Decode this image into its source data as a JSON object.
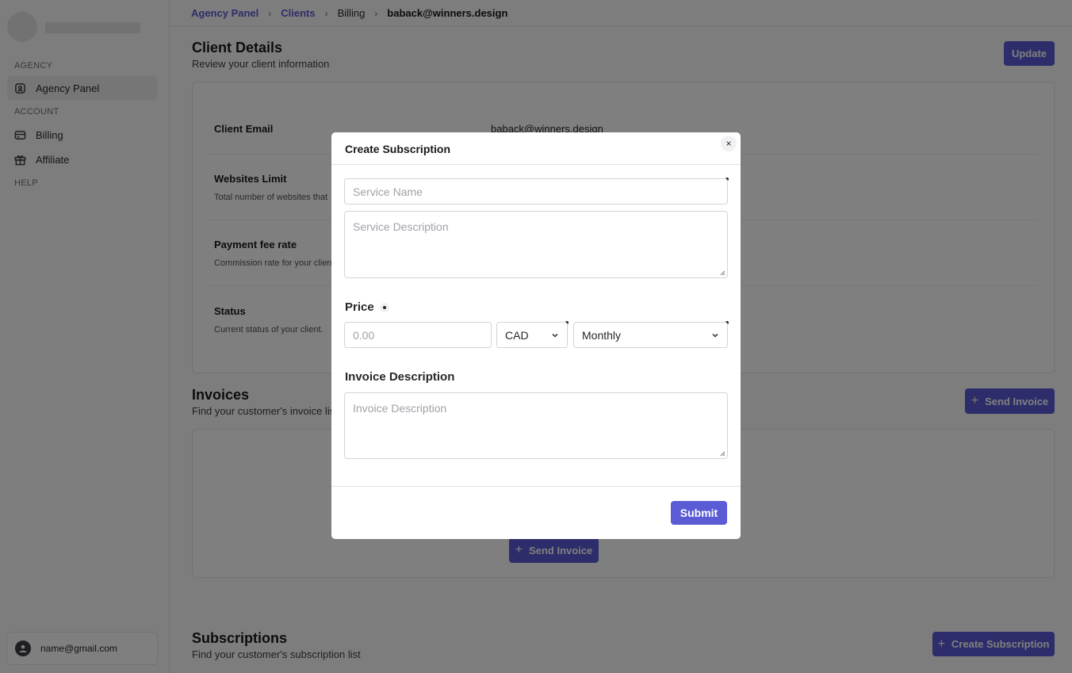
{
  "breadcrumb": {
    "items": [
      "Agency Panel",
      "Clients",
      "Billing",
      "baback@winners.design"
    ]
  },
  "sidebar": {
    "section_agency": "AGENCY",
    "section_account": "ACCOUNT",
    "section_help": "HELP",
    "items": [
      {
        "label": "Agency Panel",
        "icon": "agency-icon"
      },
      {
        "label": "Billing",
        "icon": "credit-card-icon"
      },
      {
        "label": "Affiliate",
        "icon": "gift-icon"
      }
    ],
    "user_email": "name@gmail.com"
  },
  "client_details": {
    "title": "Client Details",
    "subtitle": "Review your client information",
    "update_label": "Update",
    "rows": [
      {
        "label": "Client Email",
        "desc": "",
        "value": "baback@winners.design"
      },
      {
        "label": "Websites Limit",
        "desc": "Total number of websites that"
      },
      {
        "label": "Payment fee rate",
        "desc": "Commission rate for your clien"
      },
      {
        "label": "Status",
        "desc": "Current status of your client."
      }
    ]
  },
  "invoices": {
    "title": "Invoices",
    "subtitle": "Find your customer's invoice list",
    "send_invoice_label": "Send Invoice",
    "empty_send_invoice_label": "Send Invoice"
  },
  "subscriptions": {
    "title": "Subscriptions",
    "subtitle": "Find your customer's subscription list",
    "create_label": "Create Subscription"
  },
  "modal": {
    "title": "Create Subscription",
    "close": "×",
    "service_name_placeholder": "Service Name",
    "service_description_placeholder": "Service Description",
    "price_label": "Price",
    "price_placeholder": "0.00",
    "currency": "CAD",
    "interval": "Monthly",
    "invoice_description_label": "Invoice Description",
    "invoice_description_placeholder": "Invoice Description",
    "submit_label": "Submit"
  },
  "colors": {
    "accent": "#5b5bd6",
    "overlay": "rgba(0,0,0,0.5)"
  }
}
